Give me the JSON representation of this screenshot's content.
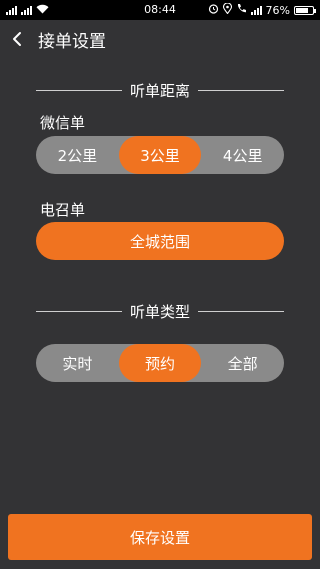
{
  "status_bar": {
    "left_icons": [
      "signal-icon",
      "signal-icon",
      "wifi-icon"
    ],
    "time": "08:44",
    "right_icons": [
      "alarm-icon",
      "location-icon",
      "call-icon",
      "signal-icon"
    ],
    "battery": "76%",
    "battery_level": 0.76
  },
  "header": {
    "back_icon": "chevron-left-icon",
    "title": "接单设置"
  },
  "distance_section": {
    "title": "听单距离",
    "wechat_label": "微信单",
    "wechat_options": [
      "2公里",
      "3公里",
      "4公里"
    ],
    "wechat_selected": "3公里",
    "dispatch_label": "电召单",
    "dispatch_value": "全城范围"
  },
  "type_section": {
    "title": "听单类型",
    "options": [
      "实时",
      "预约",
      "全部"
    ],
    "selected": "预约"
  },
  "save_button": {
    "label": "保存设置"
  },
  "colors": {
    "accent": "#f07320",
    "background": "#333335",
    "segment_inactive": "#8a8a8a"
  }
}
